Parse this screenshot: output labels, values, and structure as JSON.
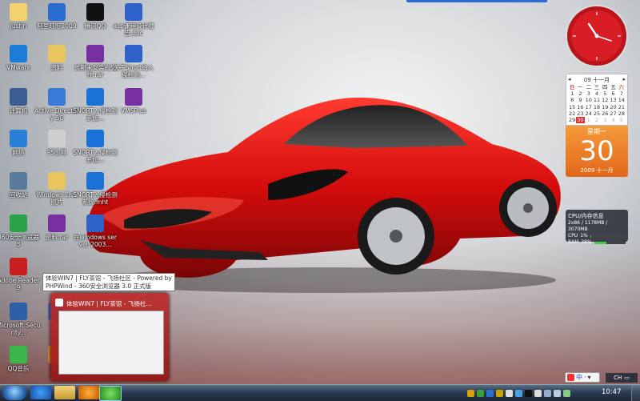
{
  "desktop_icons": [
    {
      "label": "justin"
    },
    {
      "label": "阿里旺旺2009"
    },
    {
      "label": "腾讯QQ"
    },
    {
      "label": "asp课程设计报告.doc"
    },
    {
      "label": "VMware"
    },
    {
      "label": "资料"
    },
    {
      "label": "长期未安装的文件.rar"
    },
    {
      "label": "关于Snort的入侵检测..."
    },
    {
      "label": "计算机"
    },
    {
      "label": "Active Directory 50"
    },
    {
      "label": "SNORT入侵检测系统..."
    },
    {
      "label": "VMSPlus"
    },
    {
      "label": "网络"
    },
    {
      "label": "PS工具"
    },
    {
      "label": "SNORT入侵检测系统..."
    },
    {
      "label": "回收站"
    },
    {
      "label": "Windows Live 照片"
    },
    {
      "label": "SNORT入侵检测系统.mht"
    },
    {
      "label": "360安全浏览器 3"
    },
    {
      "label": "资料.rar"
    },
    {
      "label": "在windows server 2003..."
    },
    {
      "label": "Adobe Reader 9"
    },
    {
      "label": "Microsoft Security..."
    },
    {
      "label": "税"
    },
    {
      "label": "QQ音乐"
    },
    {
      "label": "播下"
    }
  ],
  "calendar": {
    "header": "09 十一月",
    "weekdays": [
      "日",
      "一",
      "二",
      "三",
      "四",
      "五",
      "六"
    ],
    "days": [
      "1",
      "2",
      "3",
      "4",
      "5",
      "6",
      "7",
      "8",
      "9",
      "10",
      "11",
      "12",
      "13",
      "14",
      "15",
      "16",
      "17",
      "18",
      "19",
      "20",
      "21",
      "22",
      "23",
      "24",
      "25",
      "26",
      "27",
      "28",
      "29",
      "30",
      "1",
      "2",
      "3",
      "4",
      "5"
    ],
    "today": "30",
    "big_weekday": "星期一",
    "big_day": "30",
    "big_yearmonth": "2009 十一月"
  },
  "cpu_gadget": {
    "title": "CPU/内存信息",
    "memory": "2x86 / 1178MB / 3070MB",
    "cpu_label": "CPU",
    "cpu_value": "1%",
    "cpu_fraction": 0.01,
    "ram_label": "RAM",
    "ram_value": "38%",
    "ram_fraction": 0.38
  },
  "tooltip": {
    "text": "体验WIN7 | FLY茶馆 - 飞扬社区 - Powered by PHPWind - 360安全浏览器 3.0 正式版"
  },
  "thumbnail": {
    "title": "体验WIN7 | FLY茶馆 - 飞扬社..."
  },
  "taskbar": {
    "time": "10:47",
    "ime_label": "中",
    "lang_label": "CH"
  },
  "colors": {
    "car_red": "#e01010",
    "taskbar_dark": "#1b2638",
    "calendar_orange": "#f07a20"
  }
}
